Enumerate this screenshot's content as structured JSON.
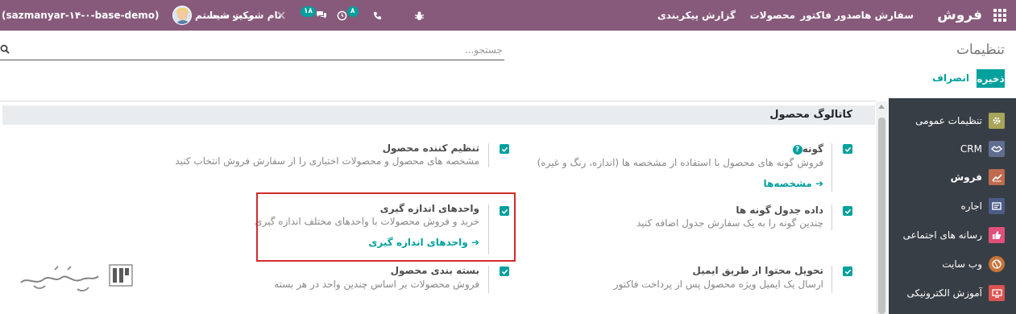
{
  "navbar": {
    "app_name": "فروش",
    "menu": [
      "سفارش ها",
      "صدور فاکتور",
      "محصولات",
      "گزارش",
      "پیکربندی"
    ],
    "messages_badge": "۱۸",
    "activities_badge": "۸",
    "company": "نام شرکت شما",
    "user": "مدیر سیستم",
    "database": "(sazmanyar-۱۴-۰-base-demo)"
  },
  "control_panel": {
    "title": "تنظیمات",
    "search_placeholder": "جستجو...",
    "save_label": "ذخیره",
    "cancel_label": "انصراف"
  },
  "sidebar": {
    "items": [
      {
        "label": "تنظیمات عمومی",
        "icon": "gear-icon",
        "color": "#a8a45a"
      },
      {
        "label": "CRM",
        "icon": "handshake-icon",
        "color": "#5f6e8f"
      },
      {
        "label": "فروش",
        "icon": "chart-icon",
        "color": "#c06b4f",
        "active": true
      },
      {
        "label": "اجاره",
        "icon": "rental-icon",
        "color": "#4b5c86"
      },
      {
        "label": "رسانه های اجتماعی",
        "icon": "thumbs-up-icon",
        "color": "#e0507a"
      },
      {
        "label": "وب سایت",
        "icon": "globe-icon",
        "color": "#c9743c"
      },
      {
        "label": "آموزش الکترونیکی",
        "icon": "elearning-icon",
        "color": "#d9534f"
      }
    ]
  },
  "section": {
    "title": "کاتالوگ محصول",
    "settings": [
      {
        "title": "گونه",
        "desc": "فروش گونه های محصول با استفاده از مشخصه ها (اندازه، رنگ و غیره)",
        "link": "مشخصه‌ها",
        "checked": true,
        "has_help": true
      },
      {
        "title": "تنظیم کننده محصول",
        "desc": "مشخصه های محصول و محصولات اختیاری را از سفارش فروش انتخاب کنید",
        "checked": true
      },
      {
        "title": "داده جدول گونه ها",
        "desc": "چندین گونه را به یک سفارش جدول اضافه کنید",
        "checked": true
      },
      {
        "title": "واحدهای اندازه گیری",
        "desc": "خرید و فروش محصولات با واحدهای مختلف اندازه گیری",
        "link": "واحدهای اندازه گیری",
        "checked": true
      },
      {
        "title": "تحویل محتوا از طریق ایمیل",
        "desc": "ارسال یک ایمیل ویژه محصول پس از پرداخت فاکتور",
        "checked": true
      },
      {
        "title": "بسته بندی محصول",
        "desc": "فروش محصولات بر اساس چندین واحد در هر بسته",
        "checked": true
      }
    ]
  },
  "watermark": {
    "text": "تسهیل‌گستر"
  },
  "colors": {
    "brand": "#875a7b",
    "accent": "#00a09d",
    "sidebar": "#383e45",
    "highlight": "#d42a2a"
  }
}
